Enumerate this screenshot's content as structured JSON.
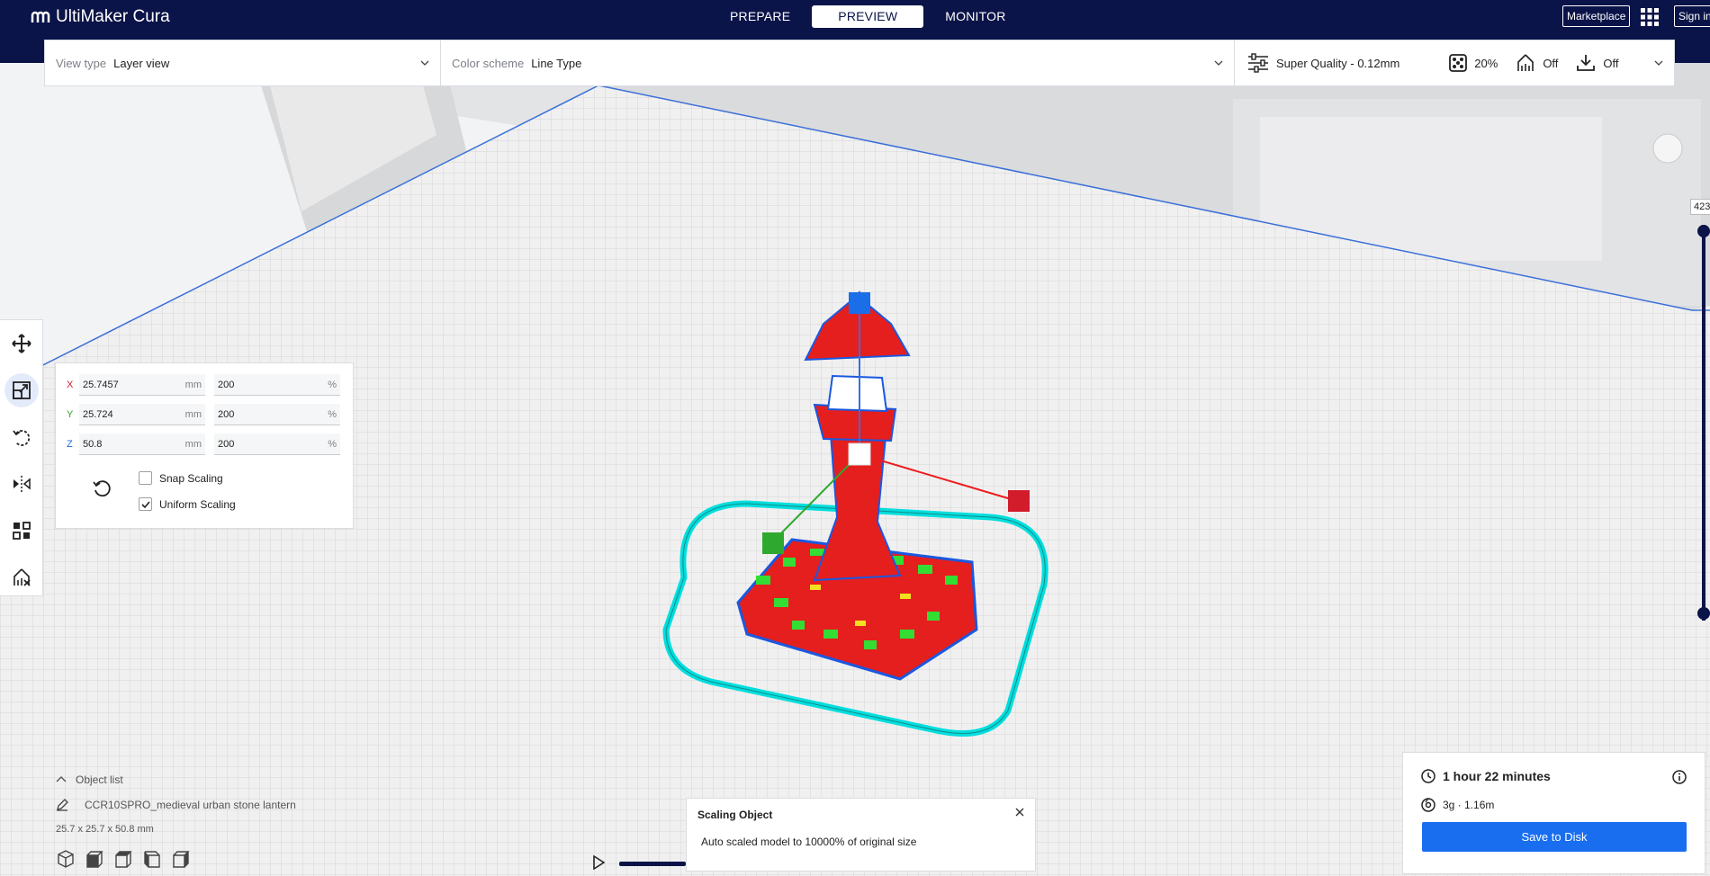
{
  "app": {
    "title": "UltiMaker Cura"
  },
  "nav": {
    "tabs": [
      {
        "label": "PREPARE",
        "active": false
      },
      {
        "label": "PREVIEW",
        "active": true
      },
      {
        "label": "MONITOR",
        "active": false
      }
    ],
    "marketplace_label": "Marketplace",
    "signin_label": "Sign in"
  },
  "header": {
    "view_type_label": "View type",
    "view_type_value": "Layer view",
    "color_scheme_label": "Color scheme",
    "color_scheme_value": "Line Type",
    "profile": "Super Quality - 0.12mm",
    "infill": "20%",
    "support": "Off",
    "adhesion": "Off"
  },
  "scale_tool": {
    "x": {
      "axis": "X",
      "mm": "25.7457",
      "percent": "200"
    },
    "y": {
      "axis": "Y",
      "mm": "25.724",
      "percent": "200"
    },
    "z": {
      "axis": "Z",
      "mm": "50.8",
      "percent": "200"
    },
    "unit_mm": "mm",
    "unit_pct": "%",
    "snap_label": "Snap Scaling",
    "snap_checked": false,
    "uniform_label": "Uniform Scaling",
    "uniform_checked": true
  },
  "object_list": {
    "title": "Object list",
    "item": "CCR10SPRO_medieval urban stone lantern",
    "dims": "25.7 x 25.7 x 50.8 mm"
  },
  "message": {
    "title": "Scaling Object",
    "text": "Auto scaled model to 10000% of original size"
  },
  "print_info": {
    "time": "1 hour 22 minutes",
    "material": "3g · 1.16m",
    "save_label": "Save to Disk"
  },
  "layer_view": {
    "current_layer": "423"
  },
  "colors": {
    "topbar": "#0b1448",
    "accent": "#196ef0",
    "model": "#ee1c1c",
    "skirt": "#00dede",
    "infill": "#33cc33"
  }
}
